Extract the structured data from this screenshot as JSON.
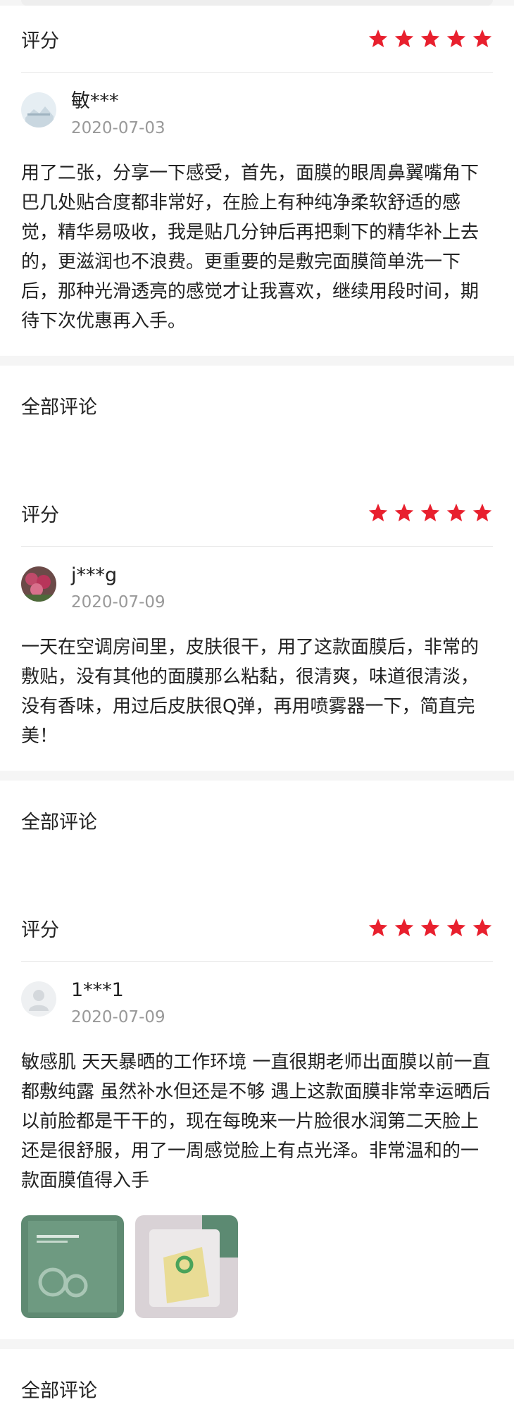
{
  "reviews": [
    {
      "rating_label": "评分",
      "stars": 5,
      "username": "敏***",
      "date": "2020-07-03",
      "text": "用了二张，分享一下感受，首先，面膜的眼周鼻翼嘴角下巴几处贴合度都非常好，在脸上有种纯净柔软舒适的感觉，精华易吸收，我是贴几分钟后再把剩下的精华补上去的，更滋润也不浪费。更重要的是敷完面膜简单洗一下后，那种光滑透亮的感觉才让我喜欢，继续用段时间，期待下次优惠再入手。",
      "all_comments": "全部评论"
    },
    {
      "rating_label": "评分",
      "stars": 5,
      "username": "j***g",
      "date": "2020-07-09",
      "text": "一天在空调房间里，皮肤很干，用了这款面膜后，非常的敷贴，没有其他的面膜那么粘黏，很清爽，味道很清淡，没有香味，用过后皮肤很Q弹，再用喷雾器一下，简直完美！",
      "all_comments": "全部评论"
    },
    {
      "rating_label": "评分",
      "stars": 5,
      "username": "1***1",
      "date": "2020-07-09",
      "text": "敏感肌 天天暴晒的工作环境 一直很期老师出面膜以前一直都敷纯露 虽然补水但还是不够 遇上这款面膜非常幸运晒后以前脸都是干干的，现在每晚来一片脸很水润第二天脸上还是很舒服，用了一周感觉脸上有点光泽。非常温和的一款面膜值得入手",
      "all_comments": "全部评论"
    }
  ],
  "colors": {
    "star": "#e8202e",
    "divider": "#e8e8e8",
    "date": "#999999",
    "section_gap": "#f5f5f5"
  }
}
